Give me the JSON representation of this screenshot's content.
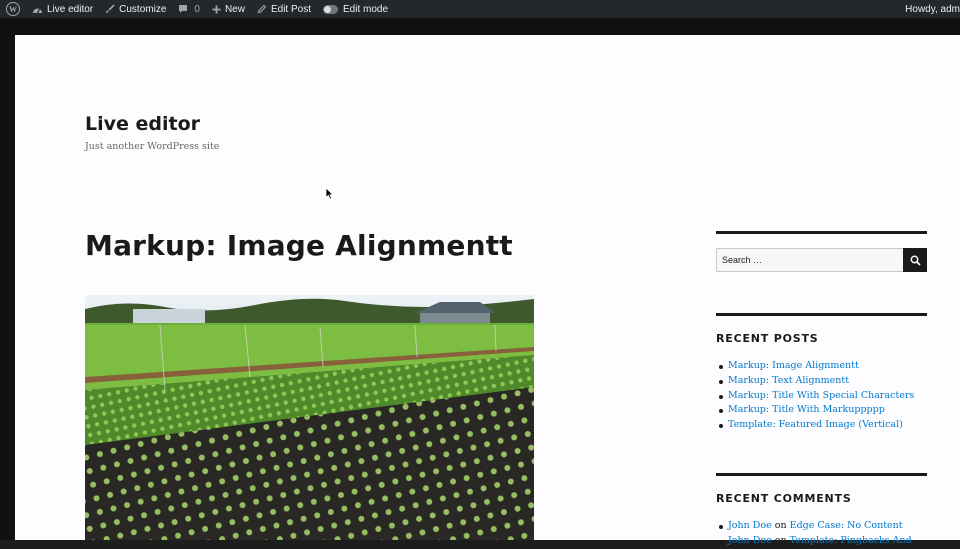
{
  "admin_bar": {
    "site_label": "Live editor",
    "customize_label": "Customize",
    "comments_count": "0",
    "new_label": "New",
    "edit_post_label": "Edit Post",
    "edit_mode_label": "Edit mode",
    "howdy_label": "Howdy, adm",
    "icons": [
      "wordpress-logo-icon",
      "dashboard-icon",
      "brush-icon",
      "comment-bubble-icon",
      "plus-icon",
      "pencil-icon",
      "toggle-icon"
    ]
  },
  "site": {
    "title": "Live editor",
    "description": "Just another WordPress site"
  },
  "post": {
    "title": "Markup: Image Alignmentt",
    "featured_image": "field-of-lettuce-rows-photo"
  },
  "sidebar": {
    "search": {
      "placeholder": "Search …"
    },
    "recent_posts": {
      "heading": "RECENT POSTS",
      "items": [
        "Markup: Image Alignmentt",
        "Markup: Text Alignmentt",
        "Markup: Title With Special Characters",
        "Markup: Title With Markuppppp",
        "Template: Featured Image (Vertical)"
      ]
    },
    "recent_comments": {
      "heading": "RECENT COMMENTS",
      "items": [
        {
          "author": "John Doe",
          "on": "on",
          "post": "Edge Case: No Content"
        },
        {
          "author": "John Doe",
          "on": "on",
          "post": "Template: Pingbacks And"
        }
      ]
    }
  },
  "colors": {
    "admin_bar_bg": "#23282d",
    "link": "#007acc",
    "text": "#1a1a1a",
    "page_bg": "#fdfcff"
  }
}
